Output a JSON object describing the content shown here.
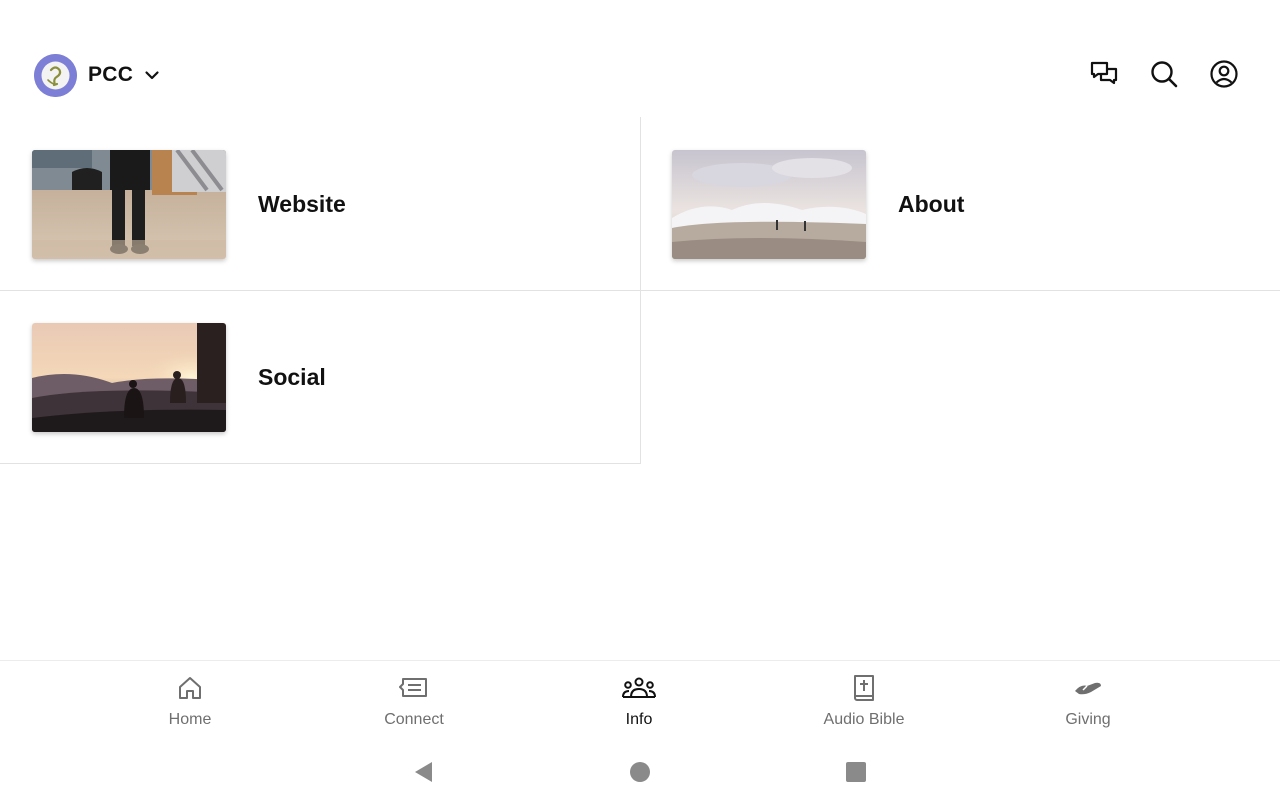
{
  "header": {
    "org_name": "PCC",
    "logo_icon": "pcc-logo-icon",
    "logo_color": "#7d7fd6",
    "actions": [
      "chat-icon",
      "search-icon",
      "account-icon"
    ]
  },
  "tiles": [
    {
      "label": "Website",
      "image": "photo-person-walking-on-sand"
    },
    {
      "label": "About",
      "image": "photo-ocean-waves-beach"
    },
    {
      "label": "Social",
      "image": "photo-people-sunset-hills"
    }
  ],
  "bottom_nav": {
    "items": [
      {
        "label": "Home",
        "icon": "home-icon",
        "active": false
      },
      {
        "label": "Connect",
        "icon": "message-card-icon",
        "active": false
      },
      {
        "label": "Info",
        "icon": "group-icon",
        "active": true
      },
      {
        "label": "Audio Bible",
        "icon": "bible-icon",
        "active": false
      },
      {
        "label": "Giving",
        "icon": "giving-hand-icon",
        "active": false
      }
    ],
    "active_color": "#111111",
    "inactive_color": "#6f6f6f"
  },
  "system_nav": [
    "back-icon",
    "home-circle-icon",
    "recents-icon"
  ]
}
